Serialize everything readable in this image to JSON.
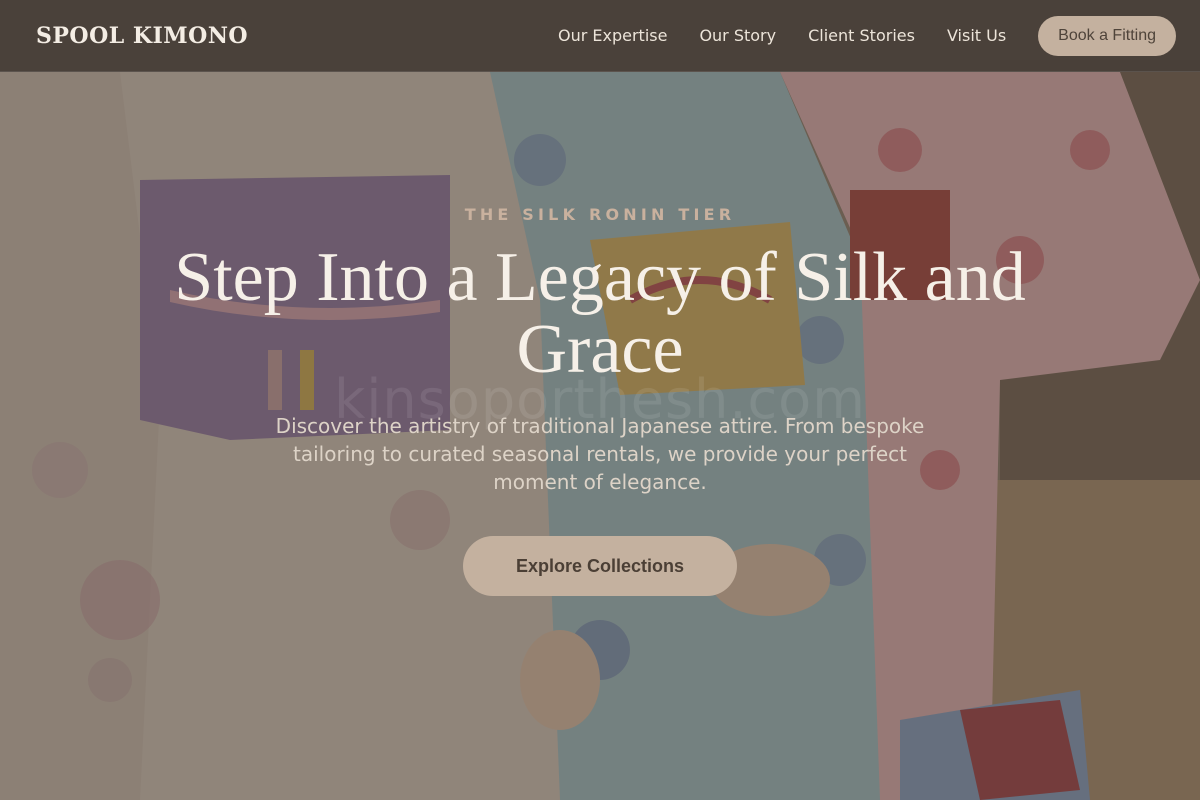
{
  "brand": {
    "name": "SPOOL KIMONO"
  },
  "nav": {
    "links": [
      "Our Expertise",
      "Our Story",
      "Client Stories",
      "Visit Us"
    ],
    "cta_label": "Book a Fitting"
  },
  "hero": {
    "eyebrow": "THE SILK RONIN TIER",
    "title": "Step Into a Legacy of Silk and Grace",
    "watermark": "kinsoporthesh.com",
    "subtitle": "Discover the artistry of traditional Japanese attire. From bespoke tailoring to curated seasonal rentals, we provide your perfect moment of elegance.",
    "cta_label": "Explore Collections"
  },
  "colors": {
    "accent": "#c4b19f",
    "nav_bg": "#484038",
    "title_text": "#f6f0e8",
    "eyebrow_text": "#c9b19e"
  }
}
